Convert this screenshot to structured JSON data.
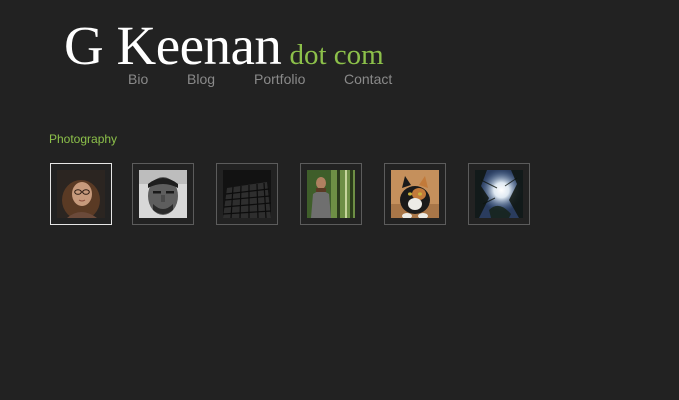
{
  "site": {
    "logo_main": "G Keenan",
    "logo_sub": "dot com"
  },
  "nav": {
    "items": [
      {
        "label": "Bio"
      },
      {
        "label": "Blog"
      },
      {
        "label": "Portfolio"
      },
      {
        "label": "Contact"
      }
    ]
  },
  "gallery": {
    "title": "Photography",
    "thumbnails": [
      {
        "subject": "woman-with-glasses"
      },
      {
        "subject": "man-portrait"
      },
      {
        "subject": "keyboard"
      },
      {
        "subject": "man-in-forest"
      },
      {
        "subject": "calico-cat"
      },
      {
        "subject": "sunlight-through-trees"
      }
    ],
    "selected_index": 0
  },
  "colors": {
    "background": "#222222",
    "accent": "#8cc04a",
    "nav_text": "#8a8a8a",
    "thumb_border": "#5c5c5c",
    "thumb_border_selected": "#e6e6e6"
  }
}
